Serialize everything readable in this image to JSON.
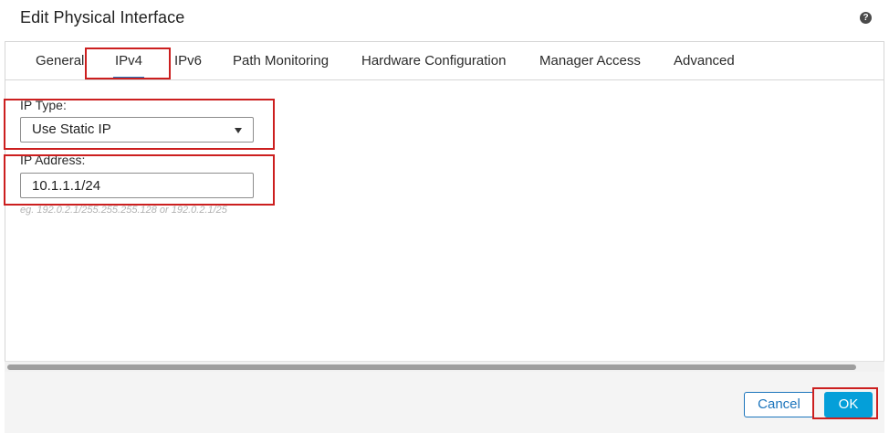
{
  "dialog": {
    "title": "Edit Physical Interface",
    "help_icon": "question-circle-icon",
    "help_glyph": "?"
  },
  "tabs": [
    {
      "label": "General",
      "active": false
    },
    {
      "label": "IPv4",
      "active": true
    },
    {
      "label": "IPv6",
      "active": false
    },
    {
      "label": "Path Monitoring",
      "active": false
    },
    {
      "label": "Hardware Configuration",
      "active": false
    },
    {
      "label": "Manager Access",
      "active": false
    },
    {
      "label": "Advanced",
      "active": false
    }
  ],
  "form": {
    "ip_type_label": "IP Type:",
    "ip_type_value": "Use Static IP",
    "ip_address_label": "IP Address:",
    "ip_address_value": "10.1.1.1/24",
    "ip_address_hint": "eg. 192.0.2.1/255.255.255.128 or 192.0.2.1/25"
  },
  "footer": {
    "cancel_label": "Cancel",
    "ok_label": "OK"
  },
  "colors": {
    "accent": "#1c75bc",
    "ok_button": "#049fd9",
    "highlight_frame": "#cc1f1f"
  }
}
